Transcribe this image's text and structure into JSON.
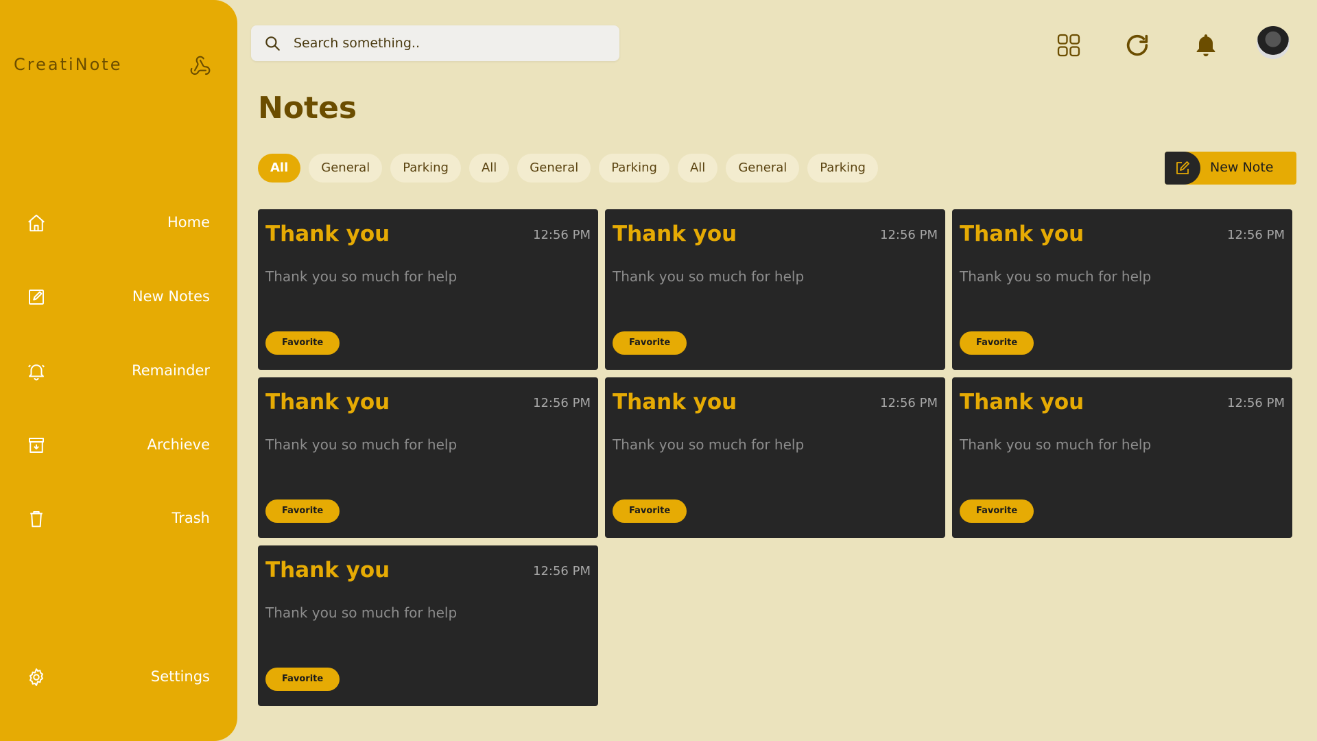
{
  "app": {
    "brand": "CreatiNote"
  },
  "sidebar": {
    "items": [
      {
        "label": "Home",
        "icon": "home-icon"
      },
      {
        "label": "New Notes",
        "icon": "edit-icon"
      },
      {
        "label": "Remainder",
        "icon": "bell-icon"
      },
      {
        "label": "Archieve",
        "icon": "archive-icon"
      },
      {
        "label": "Trash",
        "icon": "trash-icon"
      },
      {
        "label": "Settings",
        "icon": "gear-icon"
      }
    ]
  },
  "header": {
    "search_placeholder": "Search something..",
    "icons": [
      "grid-icon",
      "refresh-icon",
      "bell-icon",
      "avatar"
    ]
  },
  "main": {
    "title": "Notes",
    "filters": [
      {
        "label": "All",
        "active": true
      },
      {
        "label": "General",
        "active": false
      },
      {
        "label": "Parking",
        "active": false
      },
      {
        "label": "All",
        "active": false
      },
      {
        "label": "General",
        "active": false
      },
      {
        "label": "Parking",
        "active": false
      },
      {
        "label": "All",
        "active": false
      },
      {
        "label": "General",
        "active": false
      },
      {
        "label": "Parking",
        "active": false
      }
    ],
    "new_note_label": "New Note",
    "notes": [
      {
        "title": "Thank you",
        "time": "12:56 PM",
        "body": "Thank you so much for help",
        "tag": "Favorite"
      },
      {
        "title": "Thank you",
        "time": "12:56 PM",
        "body": "Thank you so much for help",
        "tag": "Favorite"
      },
      {
        "title": "Thank you",
        "time": "12:56 PM",
        "body": "Thank you so much for help",
        "tag": "Favorite"
      },
      {
        "title": "Thank you",
        "time": "12:56 PM",
        "body": "Thank you so much for help",
        "tag": "Favorite"
      },
      {
        "title": "Thank you",
        "time": "12:56 PM",
        "body": "Thank you so much for help",
        "tag": "Favorite"
      },
      {
        "title": "Thank you",
        "time": "12:56 PM",
        "body": "Thank you so much for help",
        "tag": "Favorite"
      },
      {
        "title": "Thank you",
        "time": "12:56 PM",
        "body": "Thank you so much for help",
        "tag": "Favorite"
      }
    ]
  },
  "colors": {
    "accent": "#e6ab04",
    "background": "#ebe3bd",
    "card": "#262626",
    "heading": "#6b4d00"
  }
}
